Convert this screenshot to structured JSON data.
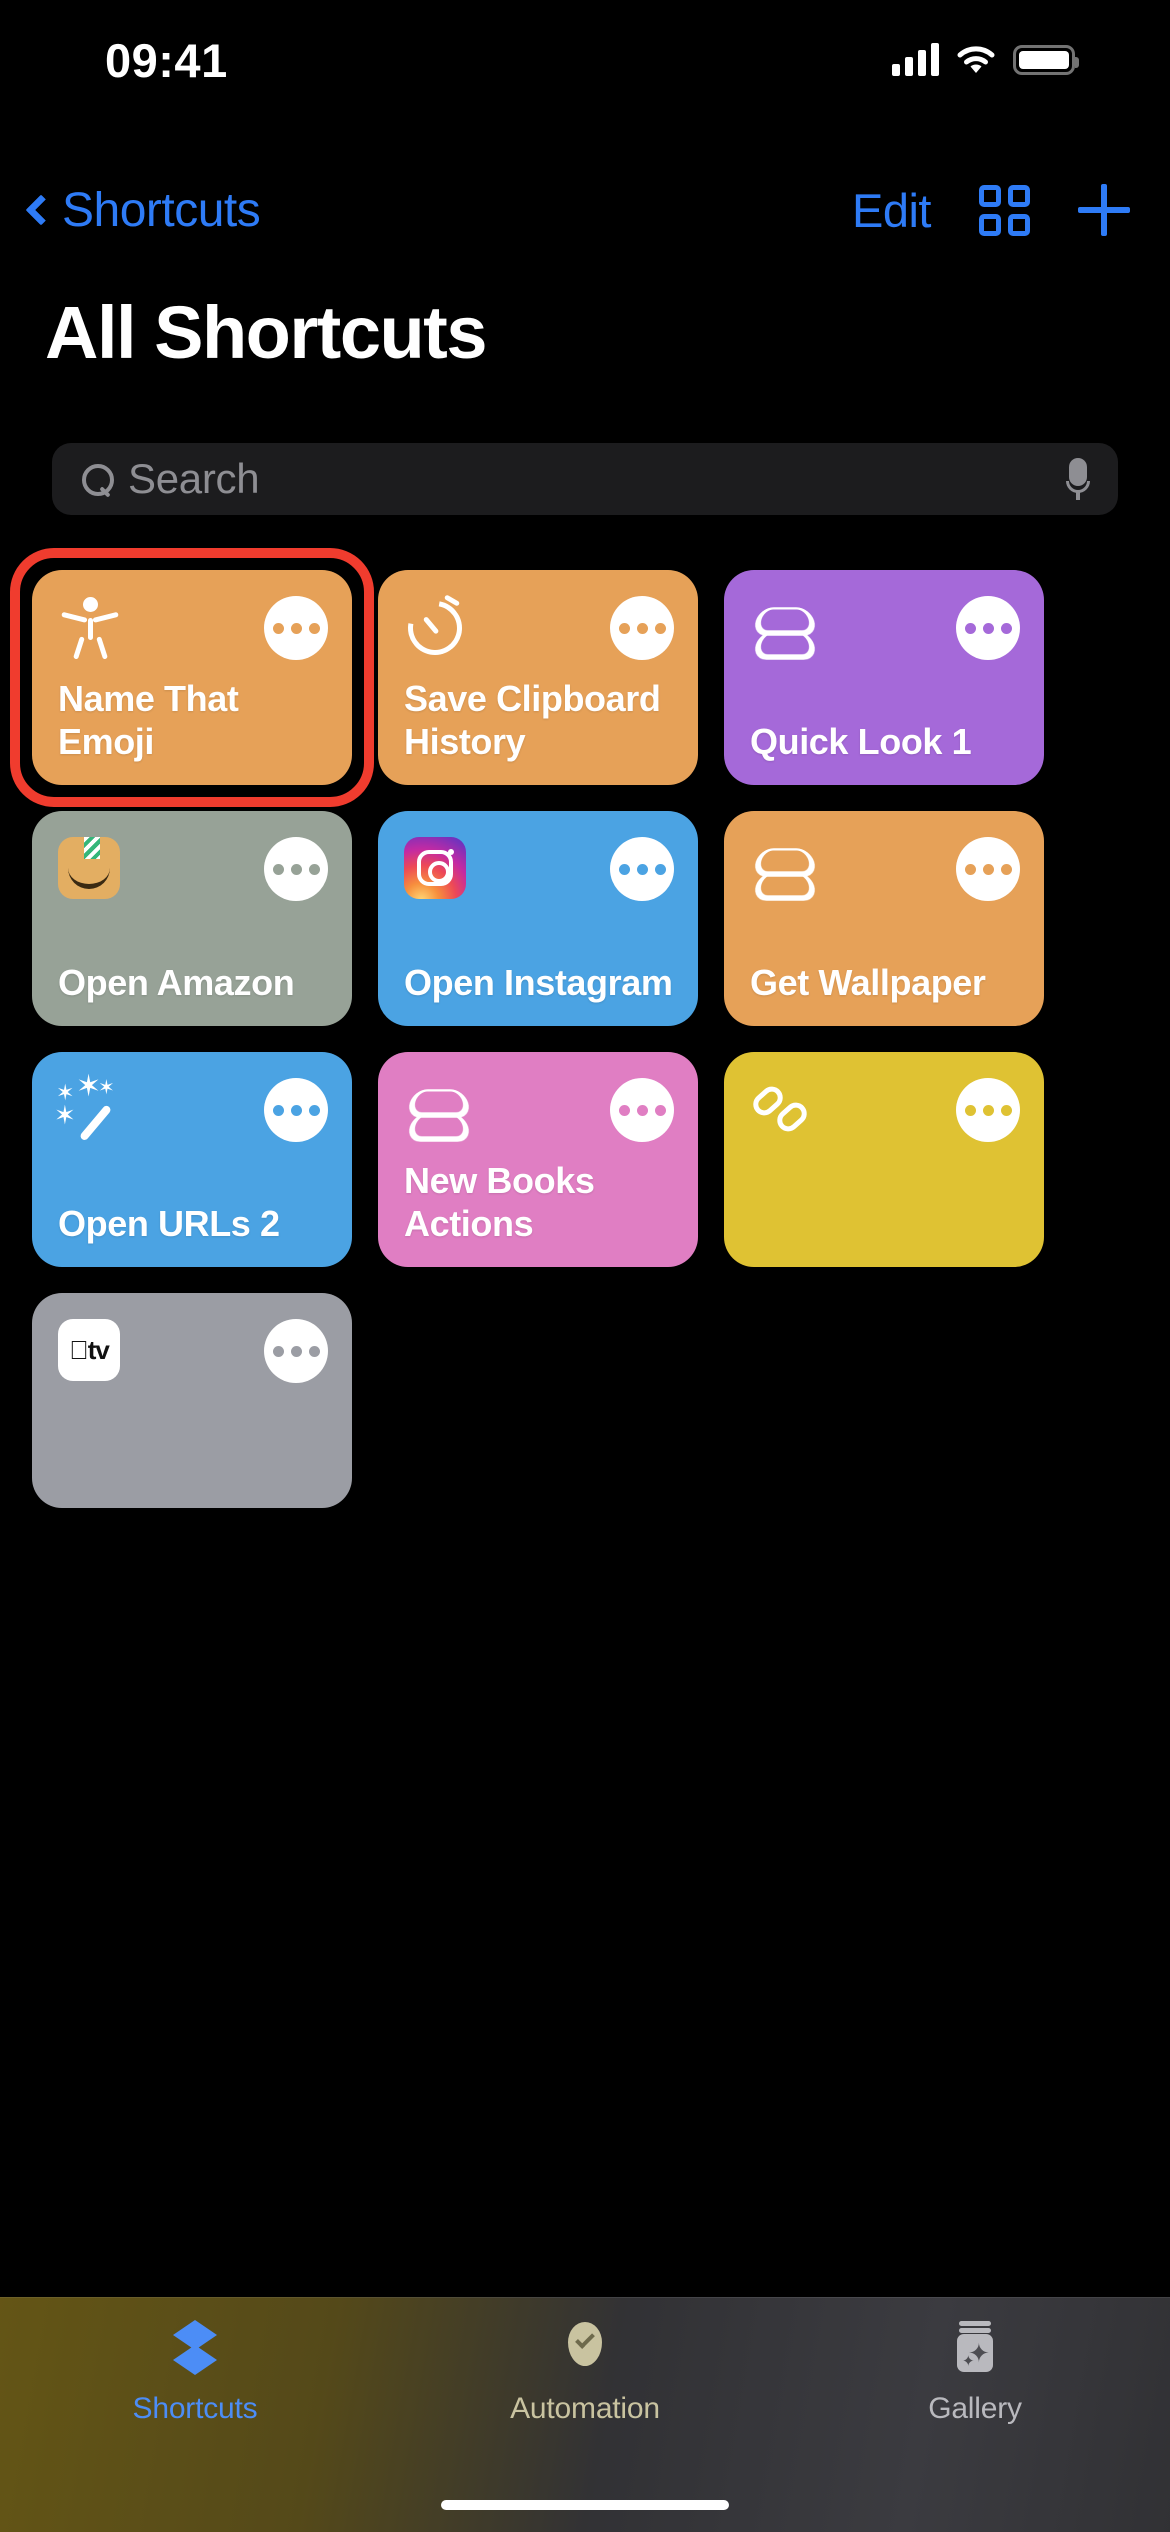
{
  "status_bar": {
    "time": "09:41",
    "cellular_icon": "signal-bars-icon",
    "wifi_icon": "wifi-icon",
    "battery_icon": "battery-icon"
  },
  "nav_bar": {
    "back_label": "Shortcuts",
    "back_icon": "chevron-left-icon",
    "edit_label": "Edit",
    "grid_icon": "grid-view-icon",
    "add_icon": "plus-icon",
    "accent_color": "#2E7BF6"
  },
  "page_title": "All Shortcuts",
  "search": {
    "placeholder": "Search",
    "search_icon": "search-icon",
    "dictation_icon": "microphone-icon"
  },
  "highlight": {
    "color": "#F03C2E",
    "target": "Name That Emoji"
  },
  "shortcuts": [
    {
      "title": "Name That Emoji",
      "color": "#E6A158",
      "glyph": "person-icon",
      "dot_color": "#E6A158",
      "selected": true
    },
    {
      "title": "Save Clipboard History",
      "color": "#E6A158",
      "glyph": "timer-icon",
      "dot_color": "#E6A158",
      "selected": false
    },
    {
      "title": "Quick Look 1",
      "color": "#A569D9",
      "glyph": "layers-icon",
      "dot_color": "#A569D9",
      "selected": false
    },
    {
      "title": "Open Amazon",
      "color": "#97A297",
      "glyph": "amazon-app-icon",
      "dot_color": "#97A297",
      "selected": false
    },
    {
      "title": "Open Instagram",
      "color": "#4BA3E3",
      "glyph": "instagram-app-icon",
      "dot_color": "#4BA3E3",
      "selected": false
    },
    {
      "title": "Get Wallpaper",
      "color": "#E6A158",
      "glyph": "layers-icon",
      "dot_color": "#E6A158",
      "selected": false
    },
    {
      "title": "Open URLs 2",
      "color": "#4BA3E3",
      "glyph": "magic-wand-icon",
      "dot_color": "#4BA3E3",
      "selected": false
    },
    {
      "title": "New Books Actions",
      "color": "#E07EC3",
      "glyph": "layers-icon",
      "dot_color": "#E07EC3",
      "selected": false
    },
    {
      "title": "",
      "color": "#DFC233",
      "glyph": "link-icon",
      "dot_color": "#DFC233",
      "selected": false
    },
    {
      "title": "",
      "color": "#9B9DA4",
      "glyph": "apple-tv-app-icon",
      "dot_color": "#9B9DA4",
      "selected": false
    }
  ],
  "apple_tv_label": "tv",
  "more_button_label": "More options",
  "tab_bar": {
    "tabs": [
      {
        "label": "Shortcuts",
        "icon": "shortcuts-layers-icon",
        "active": true
      },
      {
        "label": "Automation",
        "icon": "automation-check-icon",
        "active": false
      },
      {
        "label": "Gallery",
        "icon": "gallery-jar-icon",
        "active": false
      }
    ],
    "active_color": "#4C8DF6"
  }
}
